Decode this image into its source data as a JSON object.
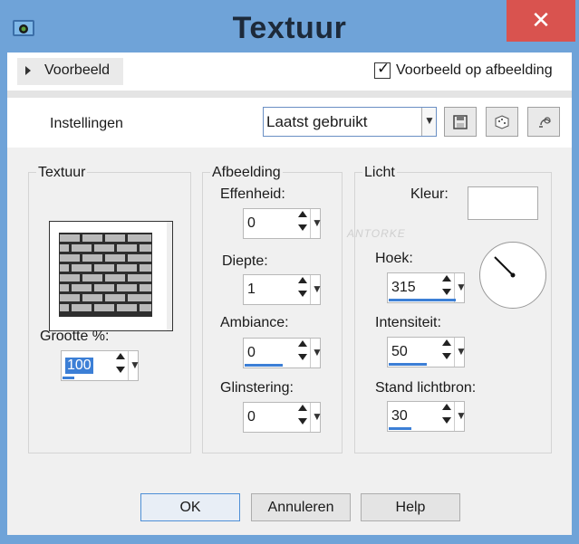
{
  "window": {
    "title": "Textuur",
    "close_glyph": "✕"
  },
  "preview": {
    "toggle_label": "Voorbeeld",
    "on_image_label": "Voorbeeld op afbeelding",
    "on_image_checked": true
  },
  "settings": {
    "label": "Instellingen",
    "preset_value": "Laatst gebruikt",
    "tool_icons": [
      "save-icon",
      "random-dice-icon",
      "reset-icon"
    ]
  },
  "texture": {
    "group_title": "Textuur",
    "size_label": "Grootte %:",
    "size_value": "100",
    "size_fraction": 0.15
  },
  "image_group": {
    "group_title": "Afbeelding",
    "fields": [
      {
        "label": "Effenheid:",
        "value": "0",
        "fraction": 0.0
      },
      {
        "label": "Diepte:",
        "value": "1",
        "fraction": 0.0
      },
      {
        "label": "Ambiance:",
        "value": "0",
        "fraction": 0.5
      },
      {
        "label": "Glinstering:",
        "value": "0",
        "fraction": 0.0
      }
    ]
  },
  "light": {
    "group_title": "Licht",
    "color_label": "Kleur:",
    "color_value": "#ffffff",
    "angle_label": "Hoek:",
    "angle_value": "315",
    "angle_fraction": 0.875,
    "intensity_label": "Intensiteit:",
    "intensity_value": "50",
    "intensity_fraction": 0.5,
    "source_label": "Stand lichtbron:",
    "source_value": "30",
    "source_fraction": 0.3
  },
  "watermark": "ANTORKE",
  "buttons": {
    "ok": "OK",
    "cancel": "Annuleren",
    "help": "Help"
  },
  "colors": {
    "titlebar": "#6fa3d8",
    "close": "#d9534f",
    "accent_bar": "#3c7fd6"
  }
}
